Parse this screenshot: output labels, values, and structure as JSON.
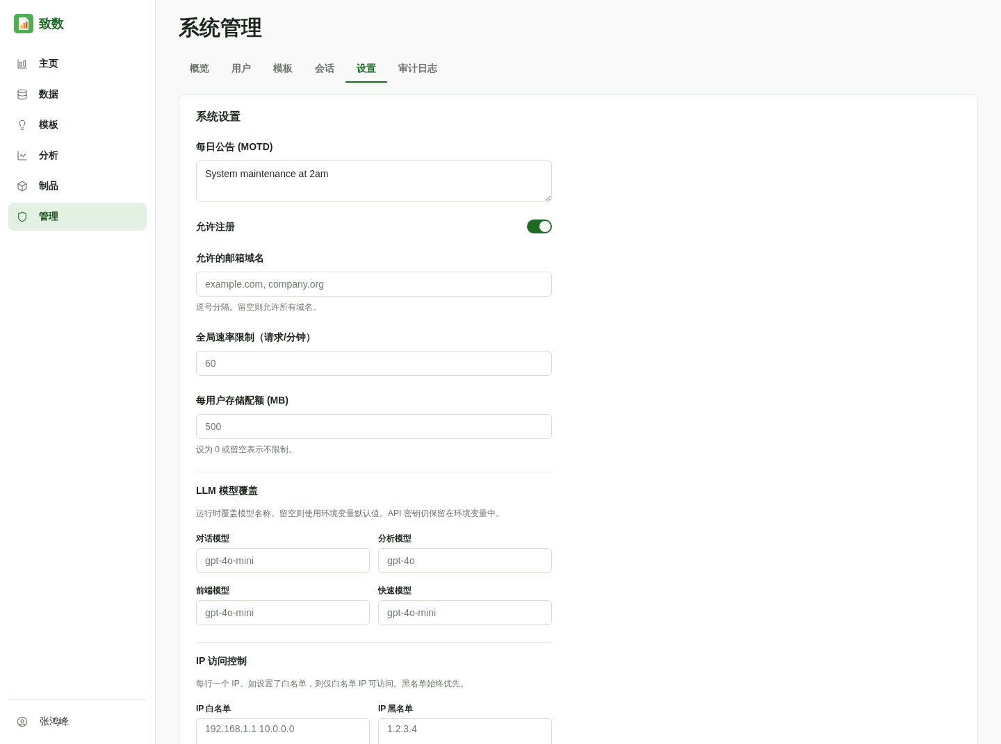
{
  "sidebar": {
    "brand": "致数",
    "nav": [
      {
        "label": "主页",
        "selected": false
      },
      {
        "label": "数据",
        "selected": false
      },
      {
        "label": "模板",
        "selected": false
      },
      {
        "label": "分析",
        "selected": false
      },
      {
        "label": "制品",
        "selected": false
      },
      {
        "label": "管理",
        "selected": true
      }
    ],
    "user": {
      "name": "张鸿峰"
    }
  },
  "header": {
    "title": "系统管理"
  },
  "tabs": [
    {
      "label": "概览",
      "selected": false
    },
    {
      "label": "用户",
      "selected": false
    },
    {
      "label": "模板",
      "selected": false
    },
    {
      "label": "会话",
      "selected": false
    },
    {
      "label": "设置",
      "selected": true
    },
    {
      "label": "审计日志",
      "selected": false
    }
  ],
  "settings": {
    "title": "系统设置",
    "fields": [
      {
        "kind": "textarea",
        "label": "每日公告 (MOTD)",
        "value": "System maintenance at 2am"
      },
      {
        "kind": "toggle",
        "label": "允许注册",
        "on": true
      },
      {
        "kind": "input",
        "label": "允许的邮箱域名",
        "placeholder": "example.com, company.org",
        "hint": "逗号分隔。留空则允许所有域名。"
      },
      {
        "kind": "input",
        "label": "全局速率限制（请求/分钟）",
        "placeholder": "60"
      },
      {
        "kind": "input",
        "label": "每用户存储配额 (MB)",
        "placeholder": "500",
        "hint": "设为 0 或留空表示不限制。"
      }
    ],
    "sections": [
      {
        "title": "LLM 模型覆盖",
        "description": "运行时覆盖模型名称。留空则使用环境变量默认值。API 密钥仍保留在环境变量中。",
        "fields": [
          {
            "kind": "input",
            "label": "对话模型",
            "placeholder": "gpt-4o-mini"
          },
          {
            "kind": "input",
            "label": "分析模型",
            "placeholder": "gpt-4o"
          },
          {
            "kind": "input",
            "label": "前端模型",
            "placeholder": "gpt-4o-mini"
          },
          {
            "kind": "input",
            "label": "快速模型",
            "placeholder": "gpt-4o-mini"
          }
        ]
      },
      {
        "title": "IP 访问控制",
        "description": "每行一个 IP。如设置了白名单，则仅白名单 IP 可访问。黑名单始终优先。",
        "fields": [
          {
            "kind": "textarea",
            "label": "IP 白名单",
            "placeholder": "192.168.1.1 10.0.0.0"
          },
          {
            "kind": "textarea",
            "label": "IP 黑名单",
            "placeholder": "1.2.3.4"
          }
        ]
      }
    ]
  }
}
